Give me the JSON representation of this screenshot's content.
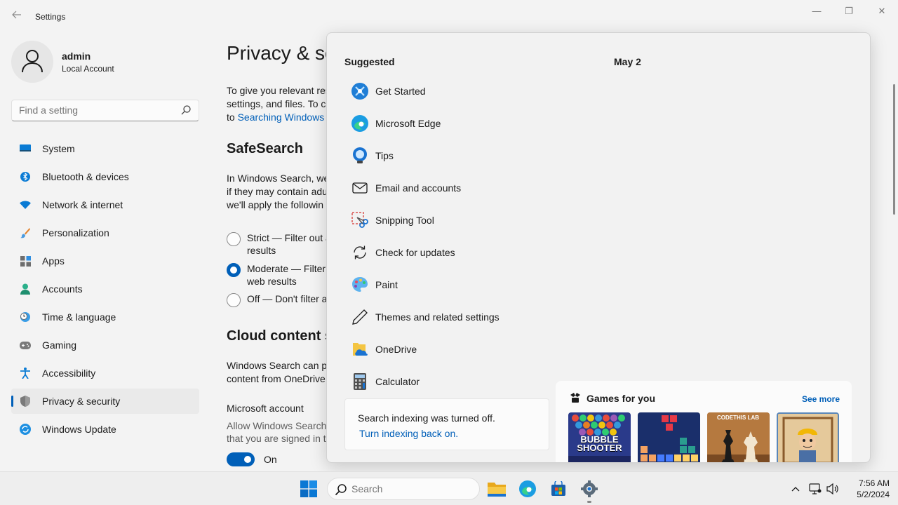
{
  "window": {
    "title": "Settings",
    "controls": {
      "minimize": "—",
      "maximize": "❐",
      "close": "✕"
    }
  },
  "profile": {
    "name": "admin",
    "account_type": "Local Account"
  },
  "find": {
    "placeholder": "Find a setting"
  },
  "nav": [
    {
      "label": "System",
      "icon": "monitor-icon"
    },
    {
      "label": "Bluetooth & devices",
      "icon": "bluetooth-icon"
    },
    {
      "label": "Network & internet",
      "icon": "wifi-icon"
    },
    {
      "label": "Personalization",
      "icon": "brush-icon"
    },
    {
      "label": "Apps",
      "icon": "apps-icon"
    },
    {
      "label": "Accounts",
      "icon": "person-icon"
    },
    {
      "label": "Time & language",
      "icon": "clock-globe-icon"
    },
    {
      "label": "Gaming",
      "icon": "gamepad-icon"
    },
    {
      "label": "Accessibility",
      "icon": "accessibility-icon"
    },
    {
      "label": "Privacy & security",
      "icon": "shield-icon",
      "active": true
    },
    {
      "label": "Windows Update",
      "icon": "update-icon"
    }
  ],
  "content": {
    "title": "Privacy & se",
    "intro_1": "To give you relevant res",
    "intro_2": "settings, and files. To ch",
    "intro_3_prefix": "to ",
    "intro_3_link": "Searching Windows",
    "safesearch_heading": "SafeSearch",
    "safesearch_1": "In Windows Search, we",
    "safesearch_2": "if they may contain adu",
    "safesearch_3": "we'll apply the followin",
    "radio_strict_1": "Strict — Filter out a",
    "radio_strict_2": "results",
    "radio_moderate_1": "Moderate — Filter",
    "radio_moderate_2": "web results",
    "radio_off": "Off — Don't filter a",
    "cloud_heading": "Cloud content s",
    "cloud_1": "Windows Search can pe",
    "cloud_2": "content from OneDrive",
    "ms_account_label": "Microsoft account",
    "ms_account_desc_1": "Allow Windows Search",
    "ms_account_desc_2": "that you are signed in t",
    "toggle_label": "On"
  },
  "flyout": {
    "suggested_heading": "Suggested",
    "date_heading": "May 2",
    "suggestions": [
      {
        "label": "Get Started",
        "icon": "get-started-icon"
      },
      {
        "label": "Microsoft Edge",
        "icon": "edge-icon"
      },
      {
        "label": "Tips",
        "icon": "tips-icon"
      },
      {
        "label": "Email and accounts",
        "icon": "mail-icon"
      },
      {
        "label": "Snipping Tool",
        "icon": "scissors-icon"
      },
      {
        "label": "Check for updates",
        "icon": "refresh-icon"
      },
      {
        "label": "Paint",
        "icon": "palette-icon"
      },
      {
        "label": "Themes and related settings",
        "icon": "pen-icon"
      },
      {
        "label": "OneDrive",
        "icon": "onedrive-icon"
      },
      {
        "label": "Calculator",
        "icon": "calculator-icon"
      }
    ],
    "index_message": "Search indexing was turned off.",
    "index_link": "Turn indexing back on.",
    "games_heading": "Games for you",
    "games_see_more": "See more",
    "game_tile_1_text": "BUBBLE SHOOTER",
    "game_tile_3_text": "CODETHIS LAB"
  },
  "taskbar": {
    "search_placeholder": "Search",
    "time": "7:56 AM",
    "date": "5/2/2024",
    "tray_chevron": "^"
  },
  "colors": {
    "accent": "#005fb8",
    "background": "#f3f3f3",
    "nav_active": "#eaeaea"
  }
}
